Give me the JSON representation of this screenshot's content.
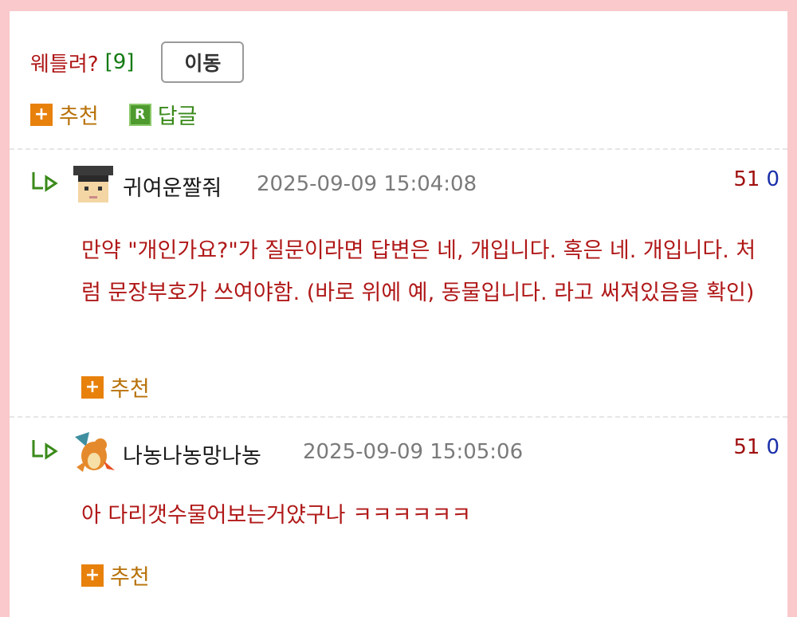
{
  "question": {
    "label": "웨틀려?",
    "count": "[9]"
  },
  "move_button": "이동",
  "post_actions": {
    "recommend": "추천",
    "reply": "답글"
  },
  "icons": {
    "plus": "+",
    "reply_badge": "R",
    "reply_arrow": "reply-arrow-icon"
  },
  "comments": [
    {
      "nickname": "귀여운짤줘",
      "datetime": "2025-09-09 15:04:08",
      "up": "51",
      "down": "0",
      "text": "만약 \"개인가요?\"가 질문이라면 답변은 네, 개입니다. 혹은 네. 개입니다. 처럼 문장부호가 쓰여야함. (바로 위에 예, 동물입니다. 라고 써져있음을 확인)",
      "recommend": "추천"
    },
    {
      "nickname": "나농나농망나농",
      "datetime": "2025-09-09 15:05:06",
      "up": "51",
      "down": "0",
      "text": "아 다리갯수물어보는거얐구나 ㅋㅋㅋㅋㅋㅋ",
      "recommend": "추천"
    }
  ],
  "colors": {
    "background": "#f9c9cb",
    "comment_text": "#b01818",
    "recommend": "#b8720a",
    "plus_icon": "#e8810c",
    "reply_icon": "#4e9a2e",
    "upvote": "#a01010",
    "downvote": "#1a2fa8"
  }
}
